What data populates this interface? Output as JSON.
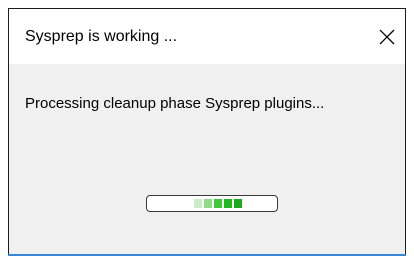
{
  "dialog": {
    "title": "Sysprep is working ...",
    "message": "Processing cleanup phase Sysprep plugins..."
  },
  "icons": {
    "close": "close-icon"
  },
  "progress": {
    "mode": "marquee",
    "block_colors": [
      "#cbeec9",
      "#8fdc8b",
      "#3fc93a",
      "#22b81f",
      "#1ea81b"
    ]
  },
  "colors": {
    "dialog_background": "#f0f0f0",
    "titlebar_background": "#ffffff",
    "accent": "#3a86d6"
  }
}
